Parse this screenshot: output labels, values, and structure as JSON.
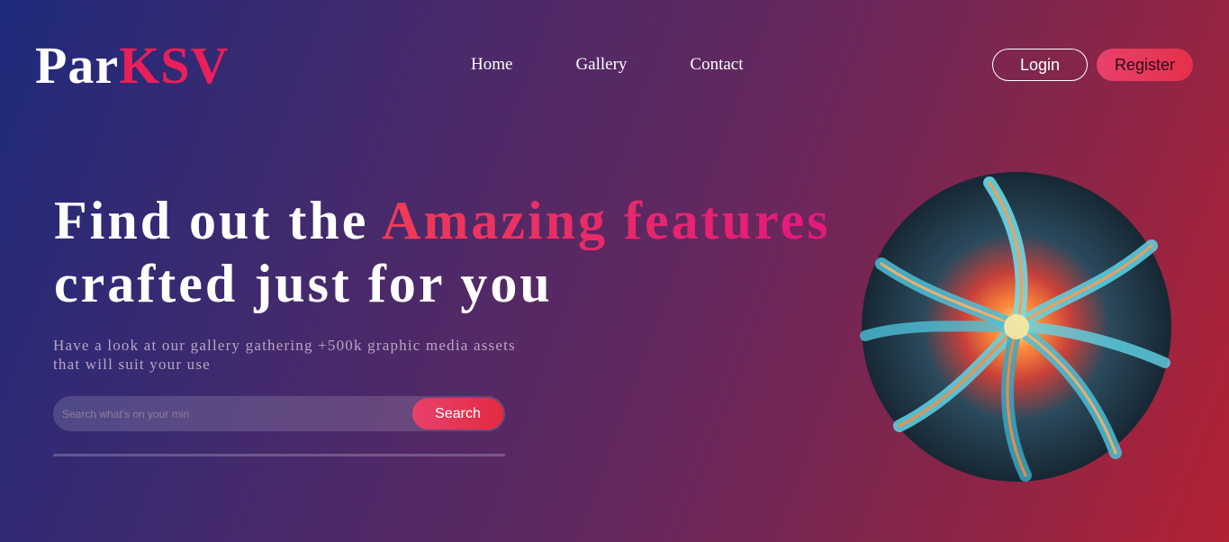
{
  "logo": {
    "part1": "Par",
    "part2": "KSV"
  },
  "nav": {
    "items": [
      {
        "label": "Home"
      },
      {
        "label": "Gallery"
      },
      {
        "label": "Contact"
      }
    ]
  },
  "auth": {
    "login": "Login",
    "register": "Register"
  },
  "hero": {
    "title_part1": "Find out the ",
    "title_accent": "Amazing features",
    "title_line2": "crafted just for you",
    "subtitle_line1": "Have a look at our gallery gathering +500k graphic media assets",
    "subtitle_line2": "that will suit your use"
  },
  "search": {
    "placeholder": "Search what's on your min",
    "button": "Search"
  },
  "colors": {
    "accent": "#ea1f5a",
    "background_start": "#1f2a7c",
    "background_end": "#b32235"
  }
}
